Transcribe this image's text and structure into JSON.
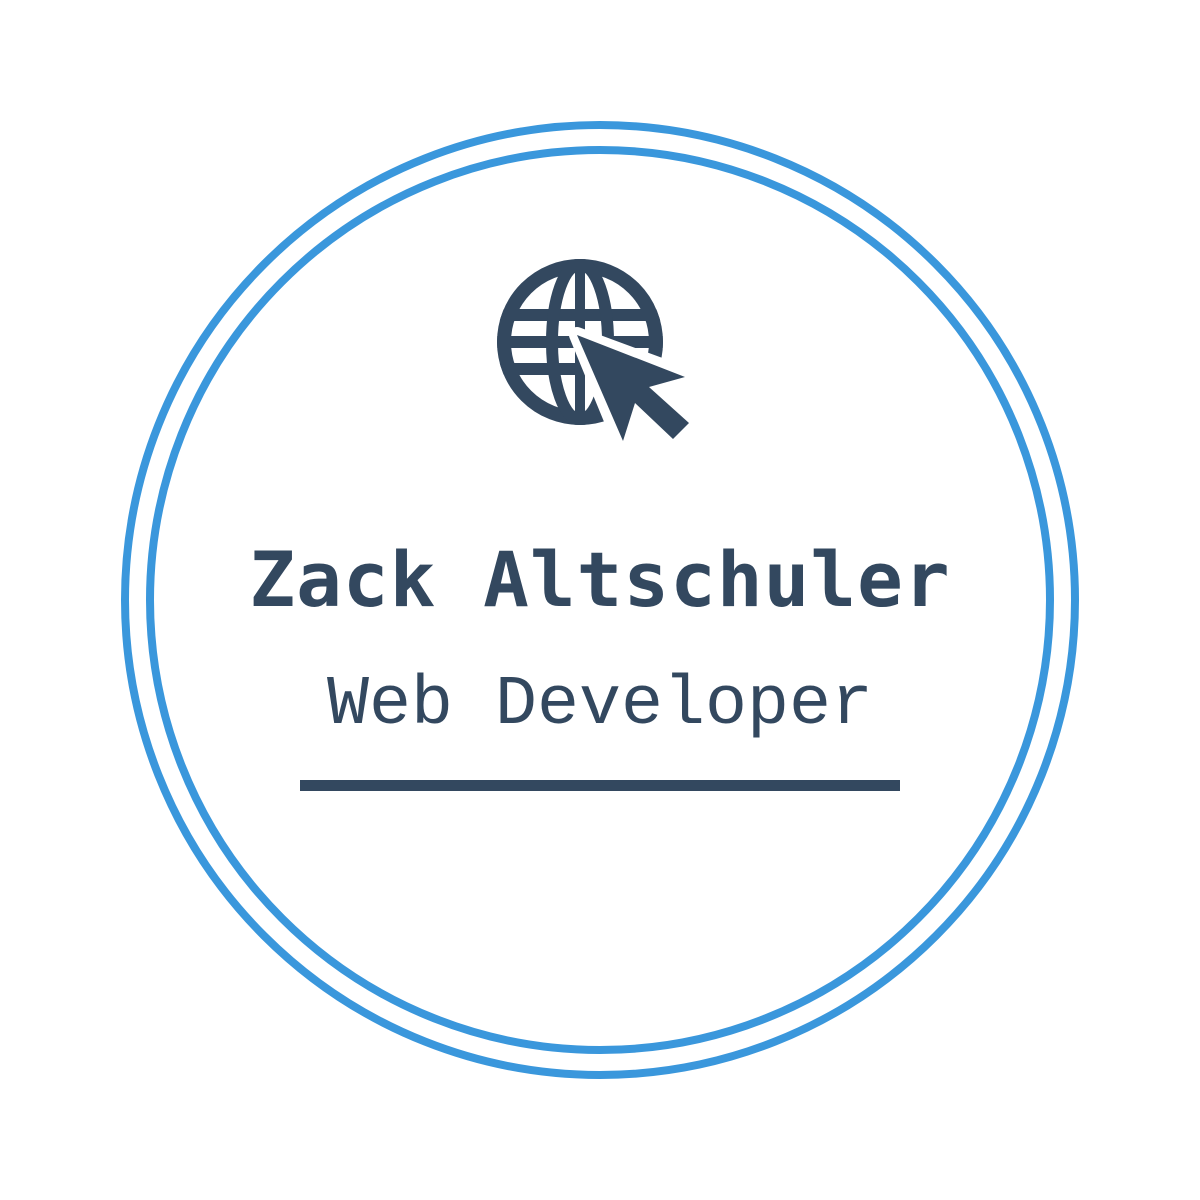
{
  "badge": {
    "name": "Zack Altschuler",
    "role": "Web Developer",
    "icon": "globe-cursor-icon"
  },
  "colors": {
    "ring": "#3a97dc",
    "text": "#33485f",
    "background": "#ffffff"
  }
}
